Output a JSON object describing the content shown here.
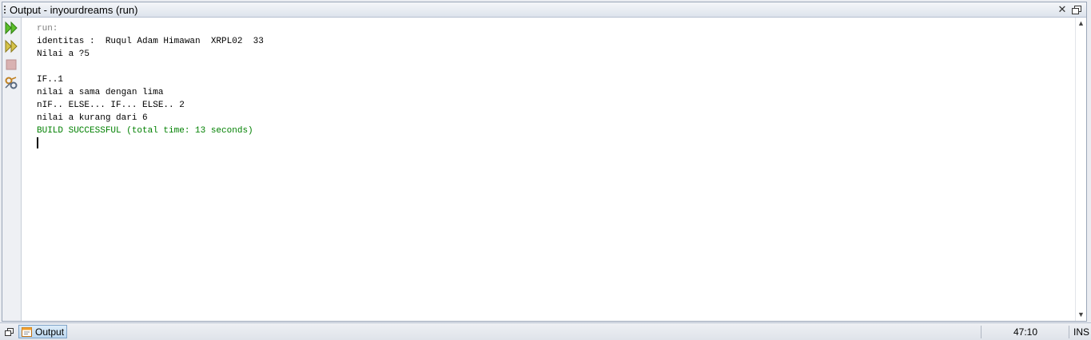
{
  "window": {
    "title": "Output - inyourdreams (run)",
    "close_symbol": "✕",
    "restore_icon": "restore-icon"
  },
  "toolbar": {
    "buttons": [
      {
        "name": "rerun-icon",
        "enabled": true
      },
      {
        "name": "rerun-with-options-icon",
        "enabled": true
      },
      {
        "name": "stop-icon",
        "enabled": false
      },
      {
        "name": "settings-icon",
        "enabled": true
      }
    ]
  },
  "output": {
    "lines": [
      {
        "text": "run:",
        "style": "gray"
      },
      {
        "text": "identitas :  Ruqul Adam Himawan  XRPL02  33",
        "style": "normal"
      },
      {
        "text": "Nilai a ?5",
        "style": "normal"
      },
      {
        "text": "",
        "style": "normal"
      },
      {
        "text": "IF..1",
        "style": "normal"
      },
      {
        "text": "nilai a sama dengan lima",
        "style": "normal"
      },
      {
        "text": "nIF.. ELSE... IF... ELSE.. 2",
        "style": "normal"
      },
      {
        "text": "nilai a kurang dari 6",
        "style": "normal"
      },
      {
        "text": "BUILD SUCCESSFUL (total time: 13 seconds)",
        "style": "green"
      }
    ],
    "colors": {
      "normal": "#000000",
      "gray": "#7f7f7f",
      "green": "#008000"
    }
  },
  "statusbar": {
    "tab_label": "Output",
    "caret_position": "47:10",
    "insert_mode": "INS"
  }
}
